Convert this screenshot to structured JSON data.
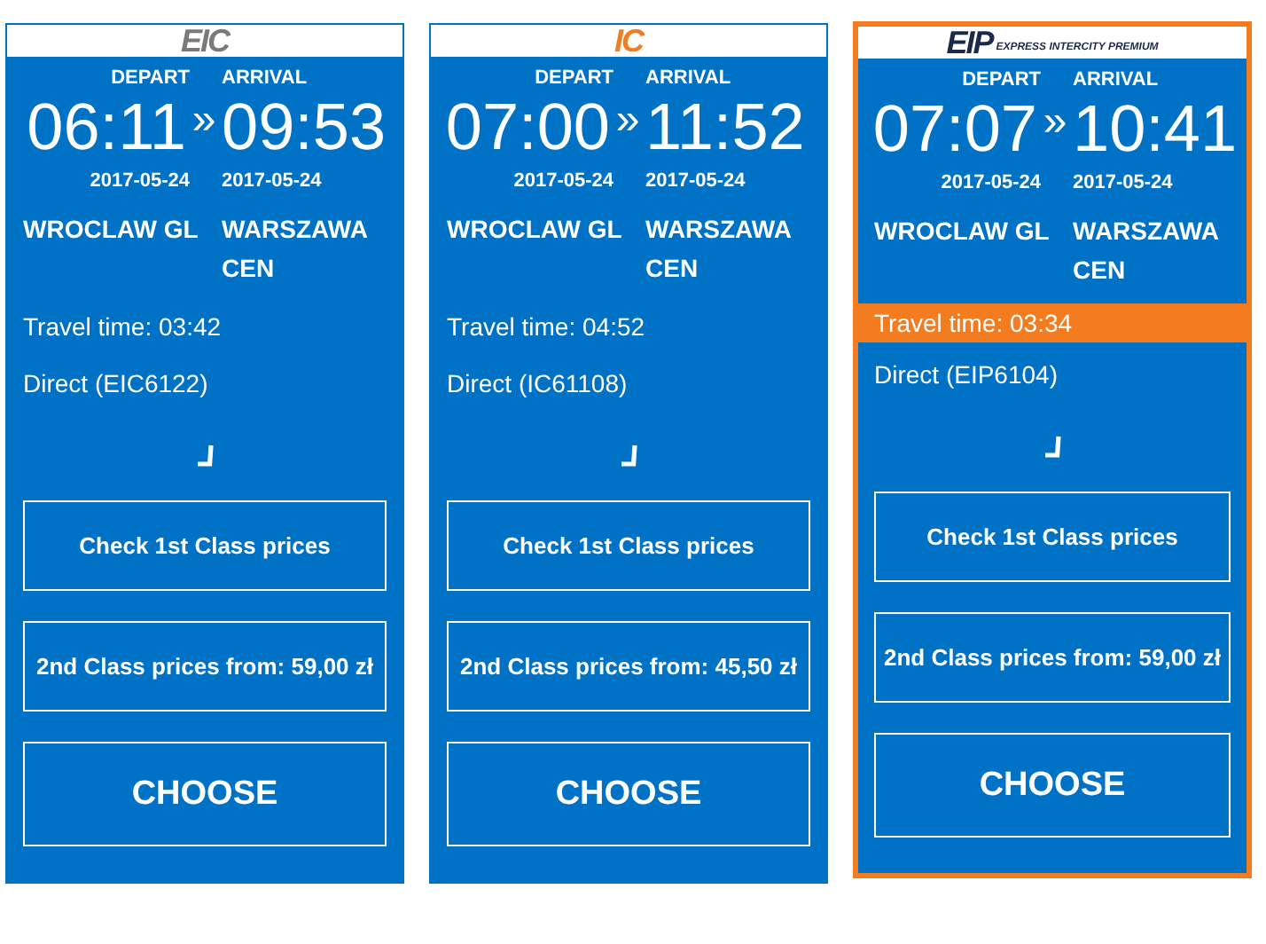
{
  "trains": [
    {
      "logo": "EIC",
      "color": "#7a7a7a",
      "selected": false,
      "depart_label": "DEPART",
      "arrival_label": "ARRIVAL",
      "depart_time": "06:11",
      "separator": "»",
      "arrival_time": "09:53",
      "depart_date": "2017-05-24",
      "arrival_date": "2017-05-24",
      "from": "WROCLAW GL",
      "to": "WARSZAWA CEN",
      "travel_time": "Travel time: 03:42",
      "connection": "Direct (EIC6122)",
      "first_class": "Check 1st Class prices",
      "second_class": "2nd Class prices from: 59,00 zł",
      "choose": "CHOOSE"
    },
    {
      "logo": "IC",
      "color": "#f47c20",
      "selected": false,
      "depart_label": "DEPART",
      "arrival_label": "ARRIVAL",
      "depart_time": "07:00",
      "separator": "»",
      "arrival_time": "11:52",
      "depart_date": "2017-05-24",
      "arrival_date": "2017-05-24",
      "from": "WROCLAW GL",
      "to": "WARSZAWA CEN",
      "travel_time": "Travel time: 04:52",
      "connection": "Direct (IC61108)",
      "first_class": "Check 1st Class prices",
      "second_class": "2nd Class prices from: 45,50 zł",
      "choose": "CHOOSE"
    },
    {
      "logo": "EIP",
      "tagline": "EXPRESS INTERCITY PREMIUM",
      "color": "#1b2a4a",
      "selected": true,
      "depart_label": "DEPART",
      "arrival_label": "ARRIVAL",
      "depart_time": "07:07",
      "separator": "»",
      "arrival_time": "10:41",
      "depart_date": "2017-05-24",
      "arrival_date": "2017-05-24",
      "from": "WROCLAW GL",
      "to": "WARSZAWA CEN",
      "travel_time": "Travel time: 03:34",
      "connection": "Direct (EIP6104)",
      "first_class": "Check 1st Class prices",
      "second_class": "2nd Class prices from: 59,00 zł",
      "choose": "CHOOSE"
    }
  ]
}
